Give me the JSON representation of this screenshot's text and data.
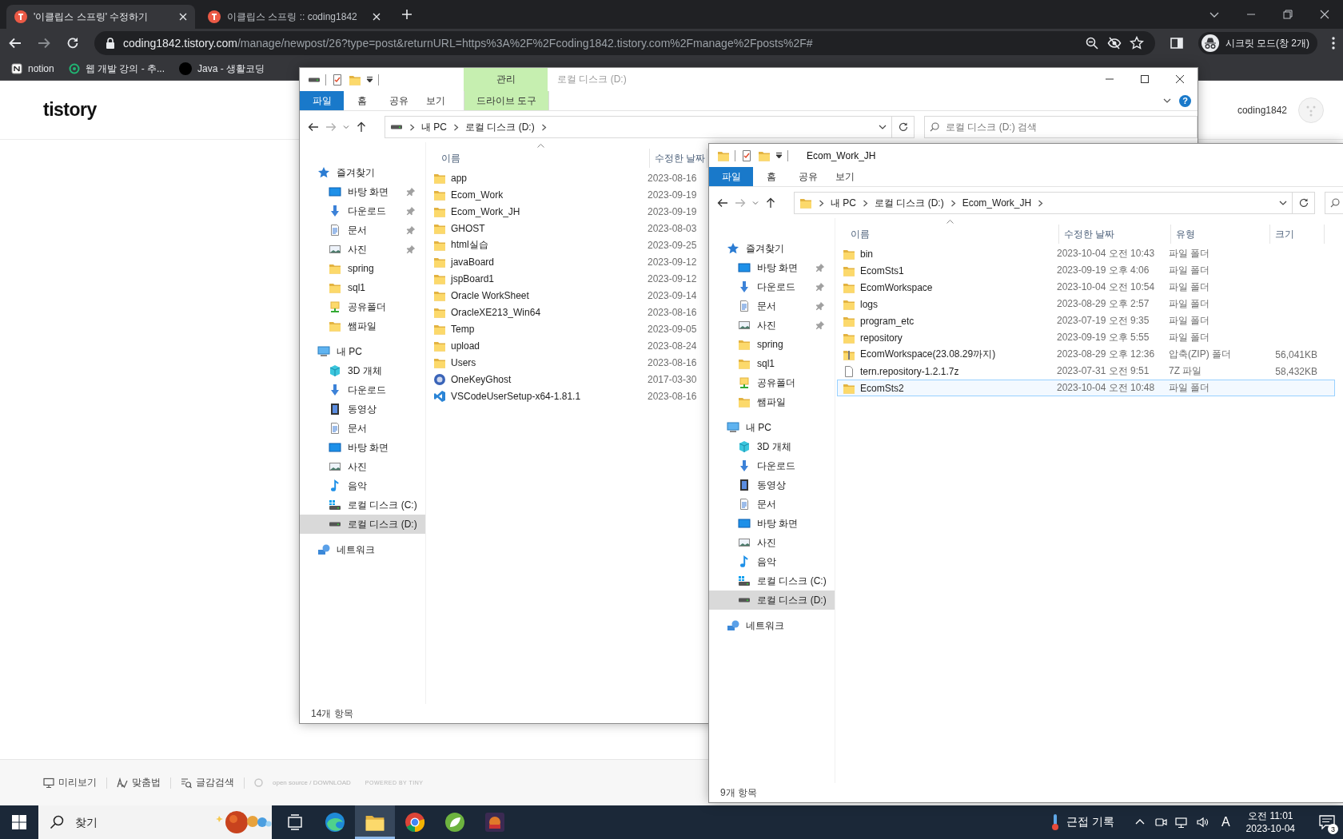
{
  "browser": {
    "tabs": [
      {
        "title": "'이클립스 스프링' 수정하기",
        "selected": true
      },
      {
        "title": "이클립스 스프링 :: coding1842",
        "selected": false
      }
    ],
    "address": {
      "host": "coding1842.tistory.com",
      "path": "/manage/newpost/26?type=post&returnURL=https%3A%2F%2Fcoding1842.tistory.com%2Fmanage%2Fposts%2F#"
    },
    "profile": "시크릿 모드(창 2개)",
    "bookmarks": [
      {
        "label": "notion"
      },
      {
        "label": "웹 개발 강의 - 추..."
      },
      {
        "label": "Java - 생활코딩"
      }
    ]
  },
  "blog": {
    "logo": "tistory",
    "user": "coding1842",
    "tools": [
      {
        "label": "미리보기"
      },
      {
        "label": "맞춤법"
      },
      {
        "label": "글감검색"
      }
    ],
    "credit": "open source / DOWNLOAD",
    "powered": "POWERED BY TINY"
  },
  "explorers": [
    {
      "title": "로컬 디스크 (D:)",
      "active": false,
      "context_group": "관리",
      "help": "?",
      "ribbon_tabs": [
        {
          "label": "파일",
          "kind": "file"
        },
        {
          "label": "홈",
          "kind": "plain"
        },
        {
          "label": "공유",
          "kind": "plain"
        },
        {
          "label": "보기",
          "kind": "plain"
        },
        {
          "label": "드라이브 도구",
          "kind": "context"
        }
      ],
      "path": [
        "내 PC",
        "로컬 디스크 (D:)"
      ],
      "search_placeholder": "로컬 디스크 (D:) 검색",
      "nav": [
        {
          "label": "즐겨찾기",
          "kind": "star",
          "selected": false,
          "children": [
            {
              "label": "바탕 화면",
              "kind": "desktop",
              "pinned": true,
              "selected": false
            },
            {
              "label": "다운로드",
              "kind": "download",
              "pinned": true,
              "selected": false
            },
            {
              "label": "문서",
              "kind": "docs",
              "pinned": true,
              "selected": false
            },
            {
              "label": "사진",
              "kind": "pictures",
              "pinned": true,
              "selected": false
            },
            {
              "label": "spring",
              "kind": "folder",
              "pinned": false,
              "selected": false
            },
            {
              "label": "sql1",
              "kind": "folder",
              "pinned": false,
              "selected": false
            },
            {
              "label": "공유폴더",
              "kind": "shared",
              "pinned": false,
              "selected": false
            },
            {
              "label": "쌤파일",
              "kind": "folder",
              "pinned": false,
              "selected": false
            }
          ]
        },
        {
          "label": "내 PC",
          "kind": "pc",
          "selected": false,
          "children": [
            {
              "label": "3D 개체",
              "kind": "cube",
              "selected": false
            },
            {
              "label": "다운로드",
              "kind": "download",
              "selected": false
            },
            {
              "label": "동영상",
              "kind": "video",
              "selected": false
            },
            {
              "label": "문서",
              "kind": "docs",
              "selected": false
            },
            {
              "label": "바탕 화면",
              "kind": "desktop",
              "selected": false
            },
            {
              "label": "사진",
              "kind": "pictures",
              "selected": false
            },
            {
              "label": "음악",
              "kind": "music",
              "selected": false
            },
            {
              "label": "로컬 디스크 (C:)",
              "kind": "drive-c",
              "selected": false
            },
            {
              "label": "로컬 디스크 (D:)",
              "kind": "drive",
              "selected": true
            }
          ]
        },
        {
          "label": "네트워크",
          "kind": "network",
          "selected": false
        }
      ],
      "columns": [
        "이름",
        "수정한 날짜"
      ],
      "files": [
        {
          "name": "app",
          "kind": "folder",
          "modified": "2023-08-16",
          "selected": false
        },
        {
          "name": "Ecom_Work",
          "kind": "folder",
          "modified": "2023-09-19",
          "selected": false
        },
        {
          "name": "Ecom_Work_JH",
          "kind": "folder",
          "modified": "2023-09-19",
          "selected": false
        },
        {
          "name": "GHOST",
          "kind": "folder",
          "modified": "2023-08-03",
          "selected": false
        },
        {
          "name": "html실습",
          "kind": "folder",
          "modified": "2023-09-25",
          "selected": false
        },
        {
          "name": "javaBoard",
          "kind": "folder",
          "modified": "2023-09-12",
          "selected": false
        },
        {
          "name": "jspBoard1",
          "kind": "folder",
          "modified": "2023-09-12",
          "selected": false
        },
        {
          "name": "Oracle WorkSheet",
          "kind": "folder",
          "modified": "2023-09-14",
          "selected": false
        },
        {
          "name": "OracleXE213_Win64",
          "kind": "folder",
          "modified": "2023-08-16",
          "selected": false
        },
        {
          "name": "Temp",
          "kind": "folder",
          "modified": "2023-09-05",
          "selected": false
        },
        {
          "name": "upload",
          "kind": "folder",
          "modified": "2023-08-24",
          "selected": false
        },
        {
          "name": "Users",
          "kind": "folder",
          "modified": "2023-08-16",
          "selected": false
        },
        {
          "name": "OneKeyGhost",
          "kind": "app",
          "modified": "2017-03-30",
          "selected": false
        },
        {
          "name": "VSCodeUserSetup-x64-1.81.1",
          "kind": "code",
          "modified": "2023-08-16",
          "selected": false
        }
      ],
      "status": "14개 항목"
    },
    {
      "title": "Ecom_Work_JH",
      "active": true,
      "ribbon_tabs": [
        {
          "label": "파일",
          "kind": "file"
        },
        {
          "label": "홈",
          "kind": "plain"
        },
        {
          "label": "공유",
          "kind": "plain"
        },
        {
          "label": "보기",
          "kind": "plain"
        }
      ],
      "path": [
        "내 PC",
        "로컬 디스크 (D:)",
        "Ecom_Work_JH"
      ],
      "nav": [
        {
          "label": "즐겨찾기",
          "kind": "star",
          "selected": false,
          "children": [
            {
              "label": "바탕 화면",
              "kind": "desktop",
              "pinned": true,
              "selected": false
            },
            {
              "label": "다운로드",
              "kind": "download",
              "pinned": true,
              "selected": false
            },
            {
              "label": "문서",
              "kind": "docs",
              "pinned": true,
              "selected": false
            },
            {
              "label": "사진",
              "kind": "pictures",
              "pinned": true,
              "selected": false
            },
            {
              "label": "spring",
              "kind": "folder",
              "pinned": false,
              "selected": false
            },
            {
              "label": "sql1",
              "kind": "folder",
              "pinned": false,
              "selected": false
            },
            {
              "label": "공유폴더",
              "kind": "shared",
              "pinned": false,
              "selected": false
            },
            {
              "label": "쌤파일",
              "kind": "folder",
              "pinned": false,
              "selected": false
            }
          ]
        },
        {
          "label": "내 PC",
          "kind": "pc",
          "selected": false,
          "children": [
            {
              "label": "3D 개체",
              "kind": "cube",
              "selected": false
            },
            {
              "label": "다운로드",
              "kind": "download",
              "selected": false
            },
            {
              "label": "동영상",
              "kind": "video",
              "selected": false
            },
            {
              "label": "문서",
              "kind": "docs",
              "selected": false
            },
            {
              "label": "바탕 화면",
              "kind": "desktop",
              "selected": false
            },
            {
              "label": "사진",
              "kind": "pictures",
              "selected": false
            },
            {
              "label": "음악",
              "kind": "music",
              "selected": false
            },
            {
              "label": "로컬 디스크 (C:)",
              "kind": "drive-c",
              "selected": false
            },
            {
              "label": "로컬 디스크 (D:)",
              "kind": "drive",
              "selected": true
            }
          ]
        },
        {
          "label": "네트워크",
          "kind": "network",
          "selected": false
        }
      ],
      "columns": [
        "이름",
        "수정한 날짜",
        "유형",
        "크기"
      ],
      "files": [
        {
          "name": "bin",
          "kind": "folder",
          "modified": "2023-10-04 오전 10:43",
          "type": "파일 폴더",
          "selected": false
        },
        {
          "name": "EcomSts1",
          "kind": "folder",
          "modified": "2023-09-19 오후 4:06",
          "type": "파일 폴더",
          "selected": false
        },
        {
          "name": "EcomWorkspace",
          "kind": "folder",
          "modified": "2023-10-04 오전 10:54",
          "type": "파일 폴더",
          "selected": false
        },
        {
          "name": "logs",
          "kind": "folder",
          "modified": "2023-08-29 오후 2:57",
          "type": "파일 폴더",
          "selected": false
        },
        {
          "name": "program_etc",
          "kind": "folder",
          "modified": "2023-07-19 오전 9:35",
          "type": "파일 폴더",
          "selected": false
        },
        {
          "name": "repository",
          "kind": "folder",
          "modified": "2023-09-19 오후 5:55",
          "type": "파일 폴더",
          "selected": false
        },
        {
          "name": "EcomWorkspace(23.08.29까지)",
          "kind": "zip",
          "modified": "2023-08-29 오후 12:36",
          "type": "압축(ZIP) 폴더",
          "size": "56,041KB",
          "selected": false
        },
        {
          "name": "tern.repository-1.2.1.7z",
          "kind": "file",
          "modified": "2023-07-31 오전 9:51",
          "type": "7Z 파일",
          "size": "58,432KB",
          "selected": false
        },
        {
          "name": "EcomSts2",
          "kind": "folder",
          "modified": "2023-10-04 오전 10:48",
          "type": "파일 폴더",
          "selected": true
        }
      ],
      "status": "9개 항목"
    }
  ],
  "taskbar": {
    "search_placeholder": "찾기",
    "apps": [
      {
        "kind": "taskview",
        "active": false
      },
      {
        "kind": "edge",
        "active": false
      },
      {
        "kind": "explorer",
        "active": true
      },
      {
        "kind": "chrome",
        "active": false
      },
      {
        "kind": "spring",
        "active": false
      },
      {
        "kind": "game",
        "active": false
      }
    ],
    "weather": "근접 기록",
    "ime": "A",
    "time": "오전 11:01",
    "date": "2023-10-04",
    "notifications": "3"
  }
}
